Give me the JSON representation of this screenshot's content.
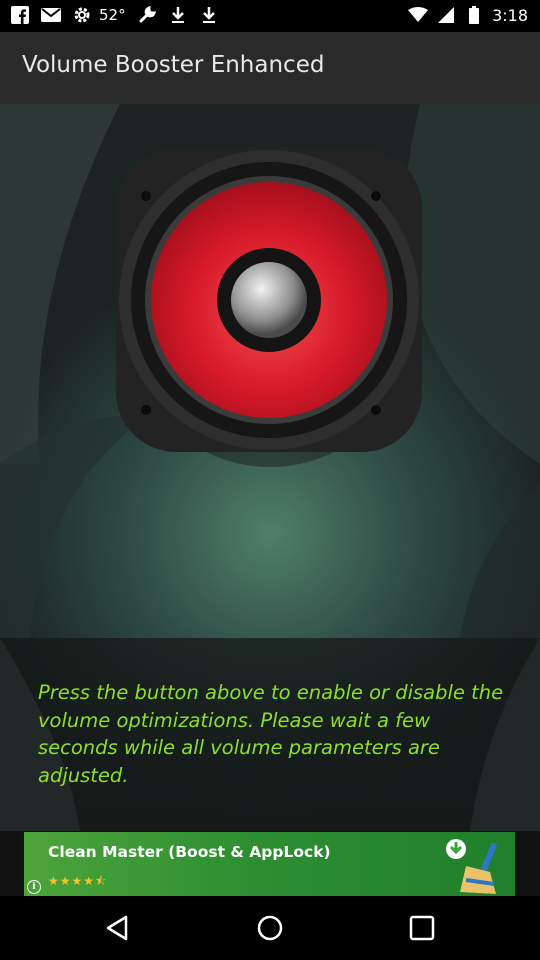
{
  "status_bar": {
    "temperature": "52°",
    "time": "3:18",
    "left_icons": [
      "facebook-icon",
      "gmail-icon",
      "settings-icon",
      "wrench-icon",
      "download-icon",
      "download-icon"
    ],
    "right_icons": [
      "wifi-icon",
      "signal-icon",
      "battery-icon"
    ]
  },
  "app_bar": {
    "title": "Volume Booster Enhanced"
  },
  "main": {
    "speaker_button": "speaker-icon",
    "message": "Press the button above to enable or disable the volume optimizations. Please wait a few seconds while all volume parameters are adjusted.",
    "message_color": "#8ede2d"
  },
  "ad": {
    "title": "Clean Master (Boost & AppLock)",
    "stars": "★★★★⯪",
    "rating": 4.5,
    "info_icon": "info-icon",
    "download_icon": "download-arrow-icon",
    "broom_icon": "broom-icon",
    "background_color": "#2d8f31"
  },
  "nav_bar": {
    "back": "back-icon",
    "home": "home-icon",
    "recents": "recents-icon"
  }
}
